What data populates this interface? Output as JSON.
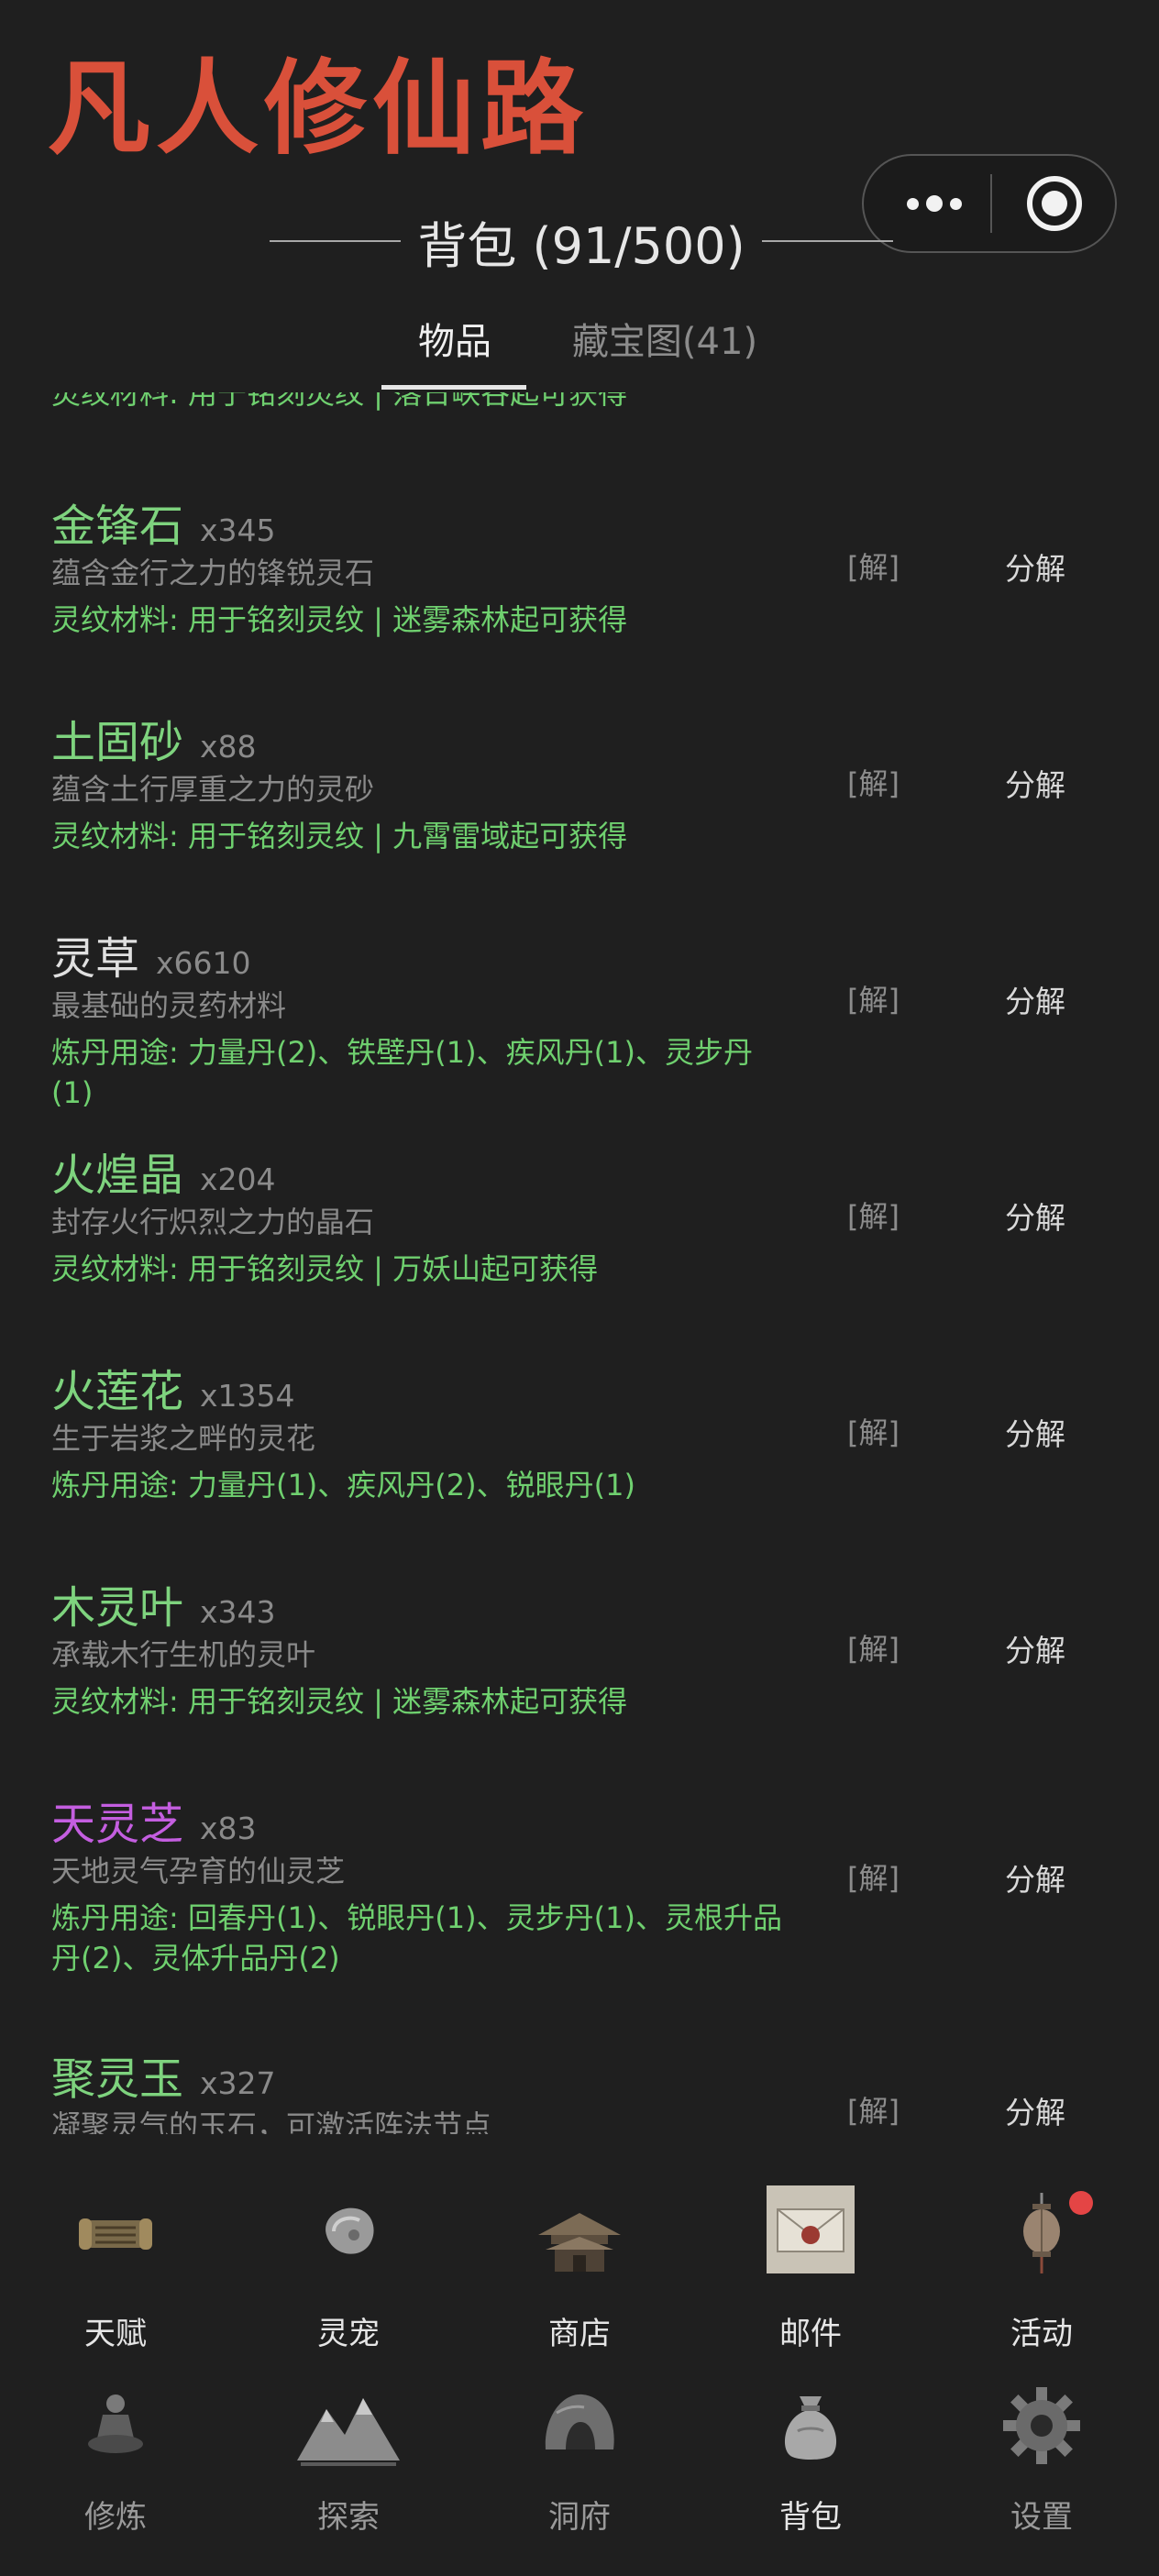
{
  "app": {
    "title": "凡人修仙路"
  },
  "bag": {
    "title": "背包 (91/500)"
  },
  "tabs": [
    {
      "label": "物品",
      "active": true
    },
    {
      "label": "藏宝图(41)",
      "active": false
    }
  ],
  "partial_item": {
    "use": "灵纹材料: 用于铭刻灵纹 | 落日峡谷起可获得"
  },
  "items": [
    {
      "name": "金锋石",
      "qty": "x345",
      "desc": "蕴含金行之力的锋锐灵石",
      "use": "灵纹材料: 用于铭刻灵纹 | 迷雾森林起可获得",
      "rarity_color": "#7ed37e",
      "jie": "[解]",
      "action": "分解"
    },
    {
      "name": "土固砂",
      "qty": "x88",
      "desc": "蕴含土行厚重之力的灵砂",
      "use": "灵纹材料: 用于铭刻灵纹 | 九霄雷域起可获得",
      "rarity_color": "#7ed37e",
      "jie": "[解]",
      "action": "分解"
    },
    {
      "name": "灵草",
      "qty": "x6610",
      "desc": "最基础的灵药材料",
      "use": "炼丹用途: 力量丹(2)、铁壁丹(1)、疾风丹(1)、灵步丹(1)",
      "rarity_color": "#e0e0e0",
      "jie": "[解]",
      "action": "分解"
    },
    {
      "name": "火煌晶",
      "qty": "x204",
      "desc": "封存火行炽烈之力的晶石",
      "use": "灵纹材料: 用于铭刻灵纹 | 万妖山起可获得",
      "rarity_color": "#7ed37e",
      "jie": "[解]",
      "action": "分解"
    },
    {
      "name": "火莲花",
      "qty": "x1354",
      "desc": "生于岩浆之畔的灵花",
      "use": "炼丹用途: 力量丹(1)、疾风丹(2)、锐眼丹(1)",
      "rarity_color": "#7ed37e",
      "jie": "[解]",
      "action": "分解"
    },
    {
      "name": "木灵叶",
      "qty": "x343",
      "desc": "承载木行生机的灵叶",
      "use": "灵纹材料: 用于铭刻灵纹 | 迷雾森林起可获得",
      "rarity_color": "#7ed37e",
      "jie": "[解]",
      "action": "分解"
    },
    {
      "name": "天灵芝",
      "qty": "x83",
      "desc": "天地灵气孕育的仙灵芝",
      "use": "炼丹用途: 回春丹(1)、锐眼丹(1)、灵步丹(1)、灵根升品丹(2)、灵体升品丹(2)",
      "rarity_color": "#c45ee0",
      "jie": "[解]",
      "action": "分解"
    },
    {
      "name": "聚灵玉",
      "qty": "x327",
      "desc": "凝聚灵气的玉石，可激活阵法节点",
      "use": "",
      "rarity_color": "#7ed37e",
      "jie": "[解]",
      "action": "分解"
    }
  ],
  "nav_row1": [
    {
      "label": "天赋",
      "icon": "scroll-icon"
    },
    {
      "label": "灵宠",
      "icon": "pet-stone-icon"
    },
    {
      "label": "商店",
      "icon": "pavilion-icon"
    },
    {
      "label": "邮件",
      "icon": "mail-envelope-icon"
    },
    {
      "label": "活动",
      "icon": "lantern-icon",
      "badge": true
    }
  ],
  "nav_row2": [
    {
      "label": "修炼",
      "icon": "meditation-icon"
    },
    {
      "label": "探索",
      "icon": "mountain-icon"
    },
    {
      "label": "洞府",
      "icon": "cave-icon"
    },
    {
      "label": "背包",
      "icon": "bag-icon",
      "active": true
    },
    {
      "label": "设置",
      "icon": "gear-icon"
    }
  ],
  "colors": {
    "title": "#d9503a",
    "common": "#7ed37e",
    "rare": "#c45ee0",
    "badge": "#e44545"
  }
}
